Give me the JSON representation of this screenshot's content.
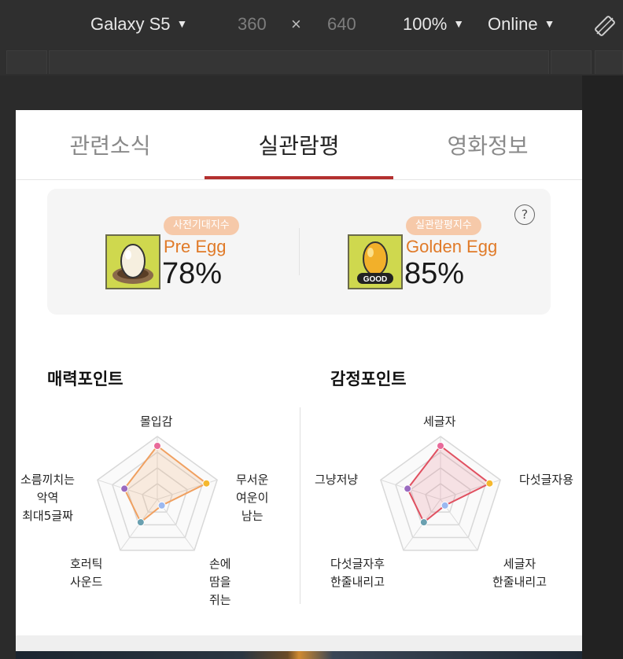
{
  "devtools": {
    "device": "Galaxy S5",
    "width": "360",
    "times": "×",
    "height": "640",
    "zoom": "100%",
    "network": "Online",
    "caret": "▼"
  },
  "tabs": [
    {
      "label": "관련소식"
    },
    {
      "label": "실관람평"
    },
    {
      "label": "영화정보"
    }
  ],
  "eggs": {
    "help": "?",
    "pre": {
      "pill": "사전기대지수",
      "name": "Pre Egg",
      "percent": "78%"
    },
    "golden": {
      "pill": "실관람평지수",
      "name": "Golden Egg",
      "percent": "85%",
      "badge": "GOOD"
    }
  },
  "charm": {
    "title": "매력포인트",
    "labels": [
      "몰입감",
      "무서운\n여운이\n남는",
      "손에\n땀을\n쥐는",
      "호러틱\n사운드",
      "소름끼치는\n악역\n최대5글짜"
    ],
    "values": [
      0.85,
      0.82,
      0.12,
      0.45,
      0.55
    ]
  },
  "emotion": {
    "title": "감정포인트",
    "labels": [
      "세글자",
      "다섯글자용",
      "세글자\n한줄내리고",
      "다섯글자후\n한줄내리고",
      "그냥저냥"
    ],
    "values": [
      0.85,
      0.82,
      0.12,
      0.45,
      0.55
    ]
  },
  "colors": {
    "accent": "#b3302f",
    "charm_line": "#f0a060",
    "emotion_line": "#e05060",
    "dot_top": "#e86a9a",
    "dot_right": "#f5b82e",
    "dot_bottom": "#9bb8f0",
    "dot_left_bottom": "#6aa0b0",
    "dot_left": "#9a6ac0"
  }
}
